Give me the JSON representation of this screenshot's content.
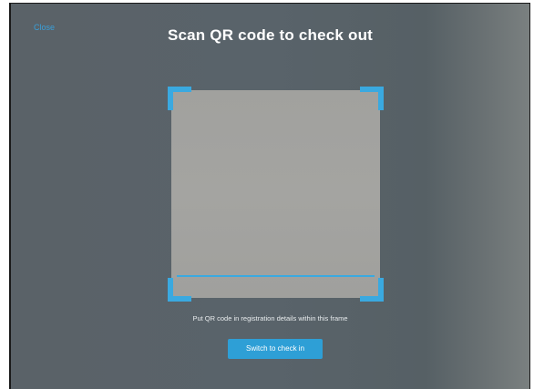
{
  "header": {
    "close_label": "Close",
    "title": "Scan QR code to check out"
  },
  "scanner": {
    "instructions": "Put QR code in registration details within this frame"
  },
  "actions": {
    "switch_label": "Switch to check in"
  },
  "colors": {
    "accent": "#3aa9e0",
    "button": "#2e9fd6",
    "background": "#5a6268",
    "viewport": "#a2a29f"
  }
}
